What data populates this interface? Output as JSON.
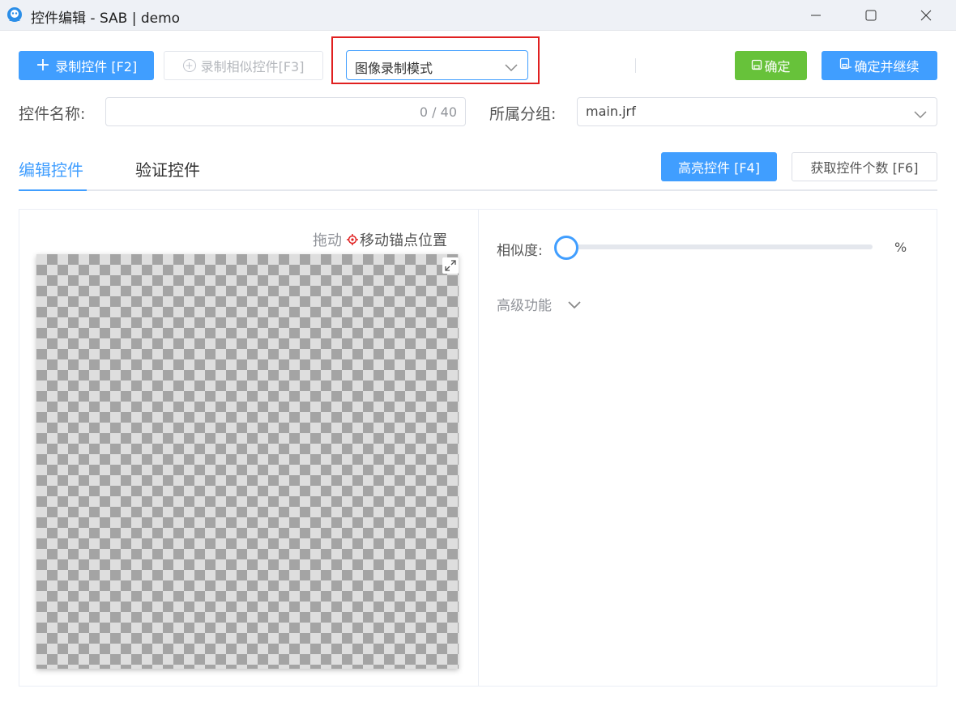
{
  "window": {
    "title": "控件编辑 - SAB | demo",
    "icons": {
      "app": "app-logo-icon",
      "minimize": "minimize-icon",
      "maximize": "maximize-icon",
      "close": "close-icon"
    }
  },
  "toolbar": {
    "record_label": "录制控件 [F2]",
    "record_similar_label": "录制相似控件[F3]",
    "mode_select": {
      "value": "图像录制模式"
    },
    "confirm_label": "确定",
    "confirm_continue_label": "确定并继续"
  },
  "form": {
    "name_label": "控件名称:",
    "name_counter": "0 / 40",
    "group_label": "所属分组:",
    "group_value": "main.jrf"
  },
  "tabs": [
    {
      "label": "编辑控件",
      "active": true
    },
    {
      "label": "验证控件",
      "active": false
    }
  ],
  "actions": {
    "highlight_label": "高亮控件 [F4]",
    "count_label": "获取控件个数 [F6]"
  },
  "preview": {
    "drag_label": "拖动",
    "anchor_label": "移动锚点位置"
  },
  "settings": {
    "similarity_label": "相似度:",
    "similarity_unit": "%",
    "similarity_value": 0,
    "advanced_label": "高级功能"
  },
  "colors": {
    "primary": "#409eff",
    "success": "#67c23a",
    "highlight_border": "#e02020",
    "anchor_red": "#e02020"
  }
}
